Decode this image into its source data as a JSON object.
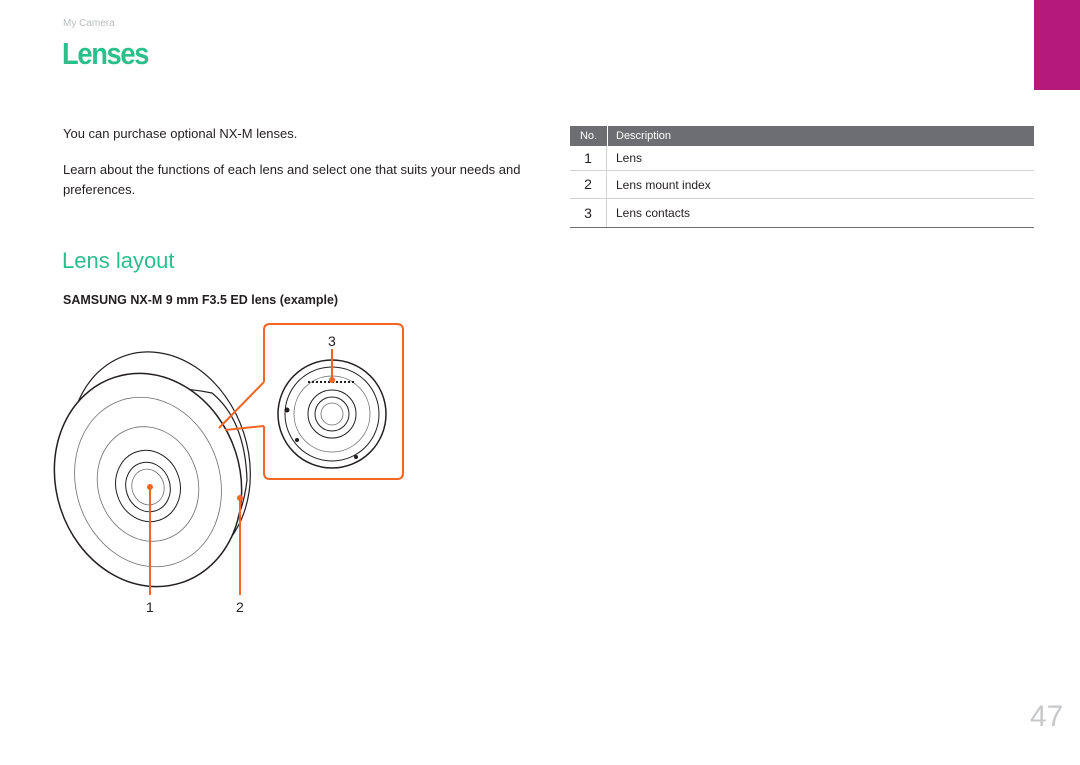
{
  "header": {
    "breadcrumb": "My Camera",
    "title": "Lenses"
  },
  "intro": {
    "para1": "You can purchase optional NX-M lenses.",
    "para2": "Learn about the functions of each lens and select one that suits your needs and preferences."
  },
  "section": {
    "heading": "Lens layout",
    "caption": "SAMSUNG NX-M 9 mm F3.5 ED lens (example)"
  },
  "diagram": {
    "callouts": [
      "1",
      "2",
      "3"
    ]
  },
  "table": {
    "headers": [
      "No.",
      "Description"
    ],
    "rows": [
      {
        "no": "1",
        "description": "Lens"
      },
      {
        "no": "2",
        "description": "Lens mount index"
      },
      {
        "no": "3",
        "description": "Lens contacts"
      }
    ]
  },
  "page_number": "47",
  "colors": {
    "title": "#2bbf8c",
    "callout_line": "#f26522",
    "side_tab": "#b5197c",
    "table_header": "#6d6e71"
  }
}
